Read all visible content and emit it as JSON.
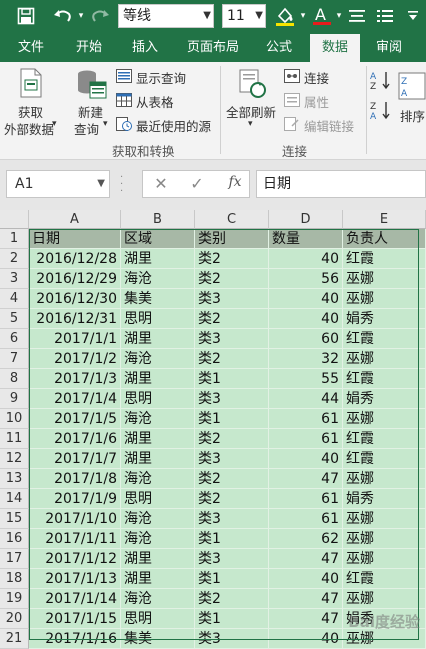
{
  "quick_access": {
    "font_name": "等线",
    "font_size": "11"
  },
  "tabs": [
    {
      "label": "文件",
      "active": false
    },
    {
      "label": "开始",
      "active": false
    },
    {
      "label": "插入",
      "active": false
    },
    {
      "label": "页面布局",
      "active": false
    },
    {
      "label": "公式",
      "active": false
    },
    {
      "label": "数据",
      "active": true
    },
    {
      "label": "审阅",
      "active": false
    }
  ],
  "ribbon": {
    "get_external_data": [
      "获取",
      "外部数据"
    ],
    "new_query": [
      "新建",
      "查询"
    ],
    "show_queries": "显示查询",
    "from_table": "从表格",
    "recent_sources": "最近使用的源",
    "group_get_transform": "获取和转换",
    "refresh_all": "全部刷新",
    "connections": "连接",
    "properties": "属性",
    "edit_links": "编辑链接",
    "group_connections": "连接",
    "sort": "排序"
  },
  "formula_bar": {
    "name_box": "A1",
    "formula": "日期"
  },
  "columns": [
    "A",
    "B",
    "C",
    "D",
    "E"
  ],
  "row_numbers": [
    "1",
    "2",
    "3",
    "4",
    "5",
    "6",
    "7",
    "8",
    "9",
    "10",
    "11",
    "12",
    "13",
    "14",
    "15",
    "16",
    "17",
    "18",
    "19",
    "20",
    "21"
  ],
  "table": {
    "headers": [
      "日期",
      "区域",
      "类别",
      "数量",
      "负责人"
    ],
    "rows": [
      [
        "2016/12/28",
        "湖里",
        "类2",
        "40",
        "红霞"
      ],
      [
        "2016/12/29",
        "海沧",
        "类2",
        "56",
        "巫娜"
      ],
      [
        "2016/12/30",
        "集美",
        "类3",
        "40",
        "巫娜"
      ],
      [
        "2016/12/31",
        "思明",
        "类2",
        "40",
        "娟秀"
      ],
      [
        "2017/1/1",
        "湖里",
        "类3",
        "60",
        "红霞"
      ],
      [
        "2017/1/2",
        "海沧",
        "类2",
        "32",
        "巫娜"
      ],
      [
        "2017/1/3",
        "湖里",
        "类1",
        "55",
        "红霞"
      ],
      [
        "2017/1/4",
        "思明",
        "类3",
        "44",
        "娟秀"
      ],
      [
        "2017/1/5",
        "海沧",
        "类1",
        "61",
        "巫娜"
      ],
      [
        "2017/1/6",
        "湖里",
        "类2",
        "61",
        "红霞"
      ],
      [
        "2017/1/7",
        "湖里",
        "类3",
        "40",
        "红霞"
      ],
      [
        "2017/1/8",
        "海沧",
        "类2",
        "47",
        "巫娜"
      ],
      [
        "2017/1/9",
        "思明",
        "类2",
        "61",
        "娟秀"
      ],
      [
        "2017/1/10",
        "海沧",
        "类3",
        "61",
        "巫娜"
      ],
      [
        "2017/1/11",
        "海沧",
        "类1",
        "62",
        "巫娜"
      ],
      [
        "2017/1/12",
        "湖里",
        "类3",
        "47",
        "巫娜"
      ],
      [
        "2017/1/13",
        "湖里",
        "类1",
        "40",
        "红霞"
      ],
      [
        "2017/1/14",
        "海沧",
        "类2",
        "47",
        "巫娜"
      ],
      [
        "2017/1/15",
        "思明",
        "类1",
        "47",
        "娟秀"
      ],
      [
        "2017/1/16",
        "集美",
        "类3",
        "40",
        "巫娜"
      ]
    ]
  },
  "watermark": "Bai度经验",
  "colors": {
    "accent": "#217346",
    "table_fill": "#c6e8cd",
    "header_fill": "#a7b8a6"
  }
}
